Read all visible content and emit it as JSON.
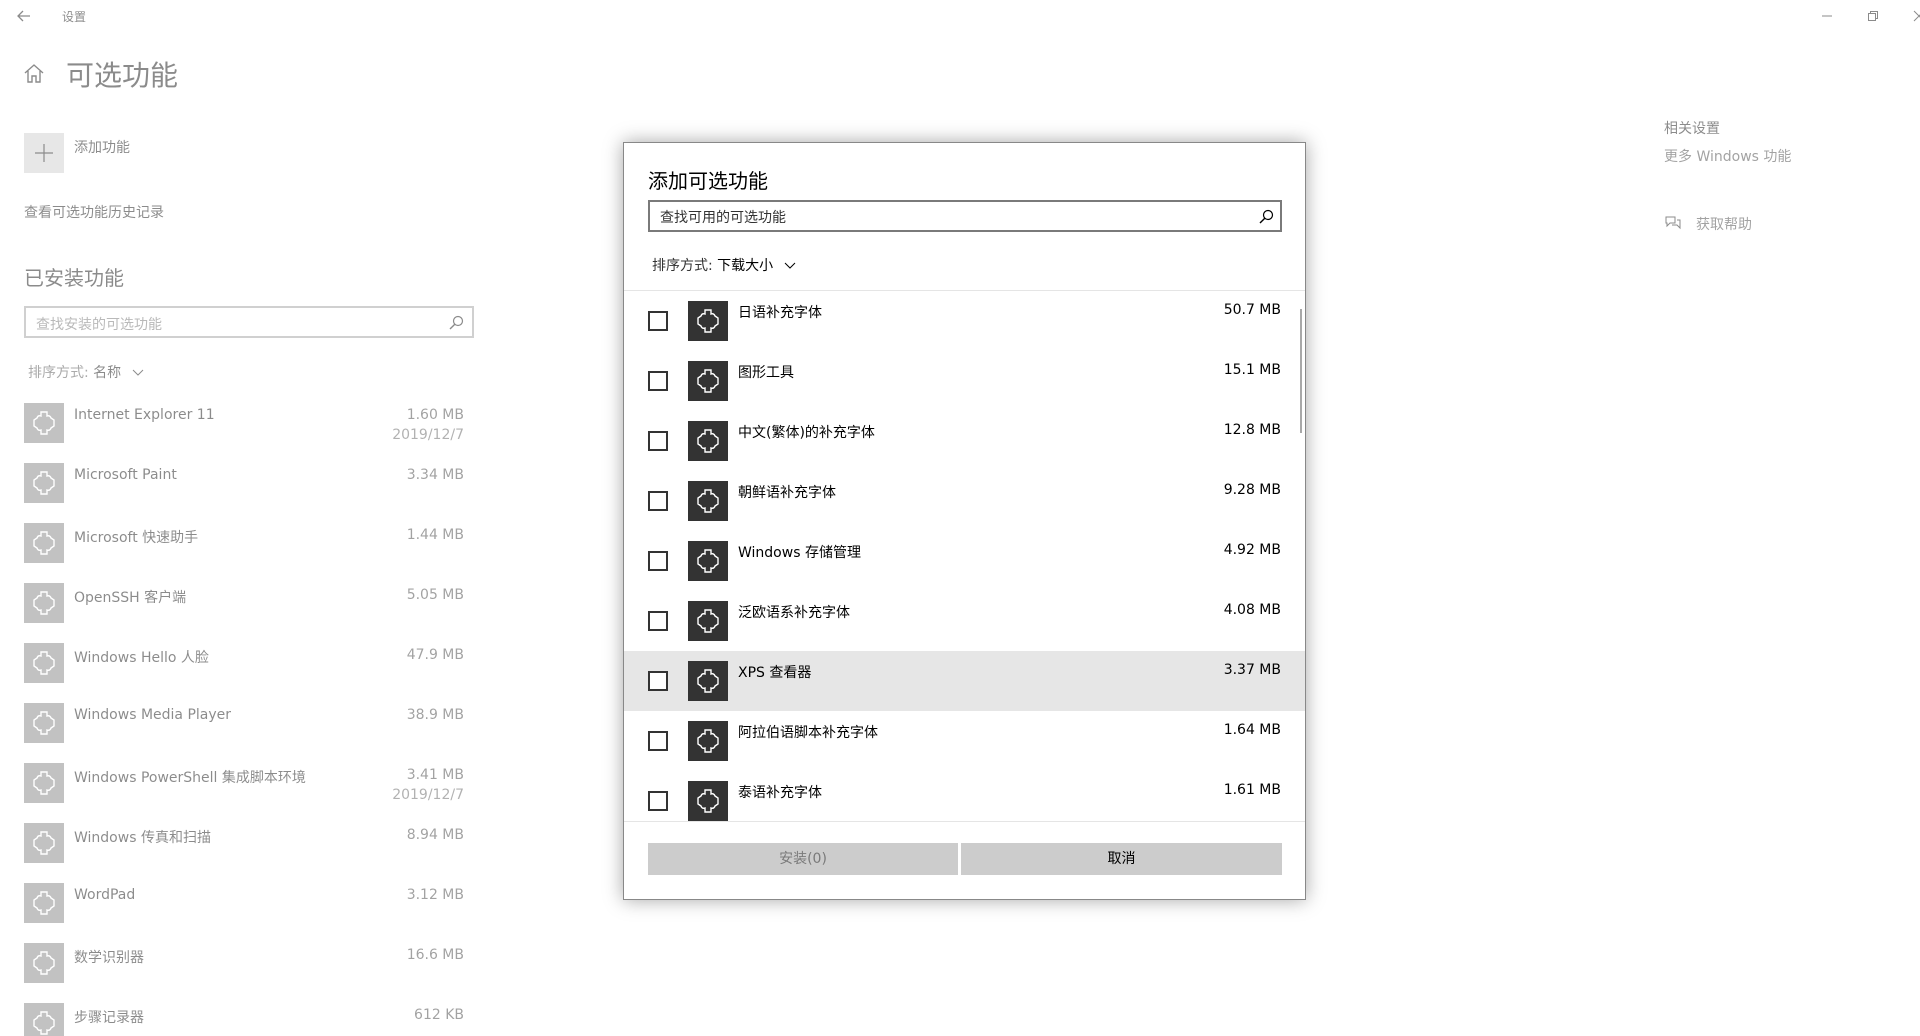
{
  "window": {
    "title": "设置",
    "back_icon": "back-arrow-icon",
    "controls": [
      "minimize-icon",
      "restore-icon",
      "close-icon"
    ]
  },
  "page": {
    "title": "可选功能",
    "add_feature_label": "添加功能",
    "history_link": "查看可选功能历史记录",
    "installed_title": "已安装功能",
    "installed_search_placeholder": "查找安装的可选功能",
    "sort_prefix": "排序方式:",
    "sort_value": "名称"
  },
  "installed": [
    {
      "name": "Internet Explorer 11",
      "size": "1.60 MB",
      "date": "2019/12/7"
    },
    {
      "name": "Microsoft Paint",
      "size": "3.34 MB",
      "date": ""
    },
    {
      "name": "Microsoft 快速助手",
      "size": "1.44 MB",
      "date": ""
    },
    {
      "name": "OpenSSH 客户端",
      "size": "5.05 MB",
      "date": ""
    },
    {
      "name": "Windows Hello 人脸",
      "size": "47.9 MB",
      "date": ""
    },
    {
      "name": "Windows Media Player",
      "size": "38.9 MB",
      "date": ""
    },
    {
      "name": "Windows PowerShell 集成脚本环境",
      "size": "3.41 MB",
      "date": "2019/12/7"
    },
    {
      "name": "Windows 传真和扫描",
      "size": "8.94 MB",
      "date": ""
    },
    {
      "name": "WordPad",
      "size": "3.12 MB",
      "date": ""
    },
    {
      "name": "数学识别器",
      "size": "16.6 MB",
      "date": ""
    },
    {
      "name": "步骤记录器",
      "size": "612 KB",
      "date": ""
    }
  ],
  "related": {
    "title": "相关设置",
    "more_windows": "更多 Windows 功能",
    "get_help": "获取帮助"
  },
  "dialog": {
    "title": "添加可选功能",
    "search_placeholder": "查找可用的可选功能",
    "sort_prefix": "排序方式:",
    "sort_value": "下载大小",
    "items": [
      {
        "name": "日语补充字体",
        "size": "50.7 MB",
        "checked": false
      },
      {
        "name": "图形工具",
        "size": "15.1 MB",
        "checked": false
      },
      {
        "name": "中文(繁体)的补充字体",
        "size": "12.8 MB",
        "checked": false
      },
      {
        "name": "朝鲜语补充字体",
        "size": "9.28 MB",
        "checked": false
      },
      {
        "name": "Windows 存储管理",
        "size": "4.92 MB",
        "checked": false
      },
      {
        "name": "泛欧语系补充字体",
        "size": "4.08 MB",
        "checked": false
      },
      {
        "name": "XPS 查看器",
        "size": "3.37 MB",
        "checked": false,
        "highlighted": true
      },
      {
        "name": "阿拉伯语脚本补充字体",
        "size": "1.64 MB",
        "checked": false
      },
      {
        "name": "泰语补充字体",
        "size": "1.61 MB",
        "checked": false
      }
    ],
    "install_label": "安装(0)",
    "cancel_label": "取消"
  }
}
